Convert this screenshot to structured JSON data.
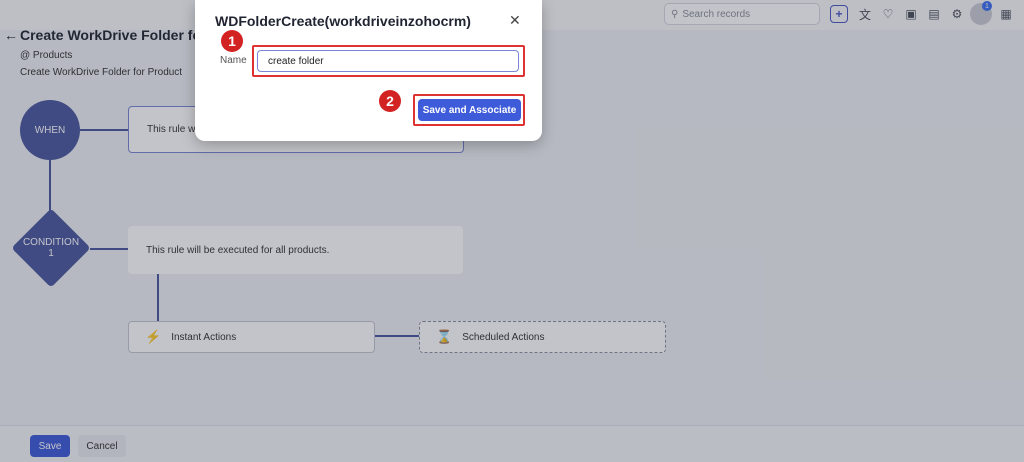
{
  "topbar": {
    "search_placeholder": "Search records",
    "notification_count": "1",
    "icons": [
      "plus-icon",
      "translate-icon",
      "bell-icon",
      "calendar-icon",
      "store-icon",
      "gear-icon",
      "avatar",
      "apps-grid-icon"
    ]
  },
  "header": {
    "title": "Create WorkDrive Folder for P",
    "module": "@ Products",
    "subtitle": "Create WorkDrive Folder for Product"
  },
  "flow": {
    "when_label": "WHEN",
    "when_rule": "This rule wi",
    "condition_label": "CONDITION",
    "condition_number": "1",
    "condition_rule": "This rule will be executed for all products.",
    "instant_actions": "Instant Actions",
    "scheduled_actions": "Scheduled Actions"
  },
  "footer": {
    "save": "Save",
    "cancel": "Cancel"
  },
  "modal": {
    "title": "WDFolderCreate(workdriveinzohocrm)",
    "name_label": "Name",
    "name_value": "create folder",
    "save_associate": "Save and Associate",
    "step1": "1",
    "step2": "2"
  },
  "colors": {
    "accent": "#3e5bd9",
    "node": "#4a58a0",
    "highlight": "#d33"
  }
}
